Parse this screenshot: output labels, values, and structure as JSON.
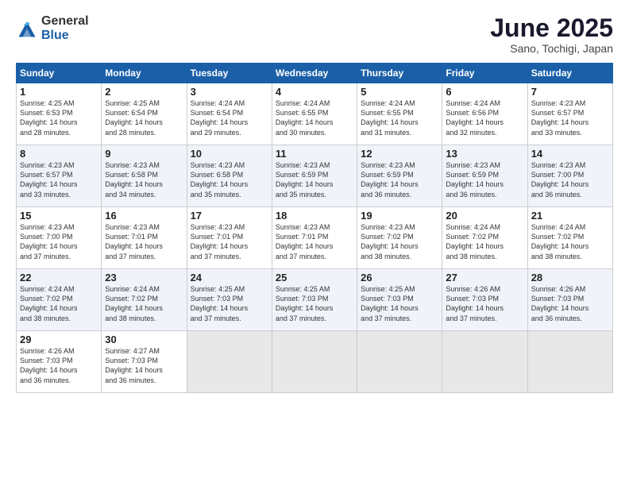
{
  "header": {
    "logo_general": "General",
    "logo_blue": "Blue",
    "month_title": "June 2025",
    "location": "Sano, Tochigi, Japan"
  },
  "days_of_week": [
    "Sunday",
    "Monday",
    "Tuesday",
    "Wednesday",
    "Thursday",
    "Friday",
    "Saturday"
  ],
  "weeks": [
    [
      {
        "day": "1",
        "sunrise": "Sunrise: 4:25 AM",
        "sunset": "Sunset: 6:53 PM",
        "daylight": "Daylight: 14 hours and 28 minutes."
      },
      {
        "day": "2",
        "sunrise": "Sunrise: 4:25 AM",
        "sunset": "Sunset: 6:54 PM",
        "daylight": "Daylight: 14 hours and 28 minutes."
      },
      {
        "day": "3",
        "sunrise": "Sunrise: 4:24 AM",
        "sunset": "Sunset: 6:54 PM",
        "daylight": "Daylight: 14 hours and 29 minutes."
      },
      {
        "day": "4",
        "sunrise": "Sunrise: 4:24 AM",
        "sunset": "Sunset: 6:55 PM",
        "daylight": "Daylight: 14 hours and 30 minutes."
      },
      {
        "day": "5",
        "sunrise": "Sunrise: 4:24 AM",
        "sunset": "Sunset: 6:55 PM",
        "daylight": "Daylight: 14 hours and 31 minutes."
      },
      {
        "day": "6",
        "sunrise": "Sunrise: 4:24 AM",
        "sunset": "Sunset: 6:56 PM",
        "daylight": "Daylight: 14 hours and 32 minutes."
      },
      {
        "day": "7",
        "sunrise": "Sunrise: 4:23 AM",
        "sunset": "Sunset: 6:57 PM",
        "daylight": "Daylight: 14 hours and 33 minutes."
      }
    ],
    [
      {
        "day": "8",
        "sunrise": "Sunrise: 4:23 AM",
        "sunset": "Sunset: 6:57 PM",
        "daylight": "Daylight: 14 hours and 33 minutes."
      },
      {
        "day": "9",
        "sunrise": "Sunrise: 4:23 AM",
        "sunset": "Sunset: 6:58 PM",
        "daylight": "Daylight: 14 hours and 34 minutes."
      },
      {
        "day": "10",
        "sunrise": "Sunrise: 4:23 AM",
        "sunset": "Sunset: 6:58 PM",
        "daylight": "Daylight: 14 hours and 35 minutes."
      },
      {
        "day": "11",
        "sunrise": "Sunrise: 4:23 AM",
        "sunset": "Sunset: 6:59 PM",
        "daylight": "Daylight: 14 hours and 35 minutes."
      },
      {
        "day": "12",
        "sunrise": "Sunrise: 4:23 AM",
        "sunset": "Sunset: 6:59 PM",
        "daylight": "Daylight: 14 hours and 36 minutes."
      },
      {
        "day": "13",
        "sunrise": "Sunrise: 4:23 AM",
        "sunset": "Sunset: 6:59 PM",
        "daylight": "Daylight: 14 hours and 36 minutes."
      },
      {
        "day": "14",
        "sunrise": "Sunrise: 4:23 AM",
        "sunset": "Sunset: 7:00 PM",
        "daylight": "Daylight: 14 hours and 36 minutes."
      }
    ],
    [
      {
        "day": "15",
        "sunrise": "Sunrise: 4:23 AM",
        "sunset": "Sunset: 7:00 PM",
        "daylight": "Daylight: 14 hours and 37 minutes."
      },
      {
        "day": "16",
        "sunrise": "Sunrise: 4:23 AM",
        "sunset": "Sunset: 7:01 PM",
        "daylight": "Daylight: 14 hours and 37 minutes."
      },
      {
        "day": "17",
        "sunrise": "Sunrise: 4:23 AM",
        "sunset": "Sunset: 7:01 PM",
        "daylight": "Daylight: 14 hours and 37 minutes."
      },
      {
        "day": "18",
        "sunrise": "Sunrise: 4:23 AM",
        "sunset": "Sunset: 7:01 PM",
        "daylight": "Daylight: 14 hours and 37 minutes."
      },
      {
        "day": "19",
        "sunrise": "Sunrise: 4:23 AM",
        "sunset": "Sunset: 7:02 PM",
        "daylight": "Daylight: 14 hours and 38 minutes."
      },
      {
        "day": "20",
        "sunrise": "Sunrise: 4:24 AM",
        "sunset": "Sunset: 7:02 PM",
        "daylight": "Daylight: 14 hours and 38 minutes."
      },
      {
        "day": "21",
        "sunrise": "Sunrise: 4:24 AM",
        "sunset": "Sunset: 7:02 PM",
        "daylight": "Daylight: 14 hours and 38 minutes."
      }
    ],
    [
      {
        "day": "22",
        "sunrise": "Sunrise: 4:24 AM",
        "sunset": "Sunset: 7:02 PM",
        "daylight": "Daylight: 14 hours and 38 minutes."
      },
      {
        "day": "23",
        "sunrise": "Sunrise: 4:24 AM",
        "sunset": "Sunset: 7:02 PM",
        "daylight": "Daylight: 14 hours and 38 minutes."
      },
      {
        "day": "24",
        "sunrise": "Sunrise: 4:25 AM",
        "sunset": "Sunset: 7:03 PM",
        "daylight": "Daylight: 14 hours and 37 minutes."
      },
      {
        "day": "25",
        "sunrise": "Sunrise: 4:25 AM",
        "sunset": "Sunset: 7:03 PM",
        "daylight": "Daylight: 14 hours and 37 minutes."
      },
      {
        "day": "26",
        "sunrise": "Sunrise: 4:25 AM",
        "sunset": "Sunset: 7:03 PM",
        "daylight": "Daylight: 14 hours and 37 minutes."
      },
      {
        "day": "27",
        "sunrise": "Sunrise: 4:26 AM",
        "sunset": "Sunset: 7:03 PM",
        "daylight": "Daylight: 14 hours and 37 minutes."
      },
      {
        "day": "28",
        "sunrise": "Sunrise: 4:26 AM",
        "sunset": "Sunset: 7:03 PM",
        "daylight": "Daylight: 14 hours and 36 minutes."
      }
    ],
    [
      {
        "day": "29",
        "sunrise": "Sunrise: 4:26 AM",
        "sunset": "Sunset: 7:03 PM",
        "daylight": "Daylight: 14 hours and 36 minutes."
      },
      {
        "day": "30",
        "sunrise": "Sunrise: 4:27 AM",
        "sunset": "Sunset: 7:03 PM",
        "daylight": "Daylight: 14 hours and 36 minutes."
      },
      null,
      null,
      null,
      null,
      null
    ]
  ]
}
